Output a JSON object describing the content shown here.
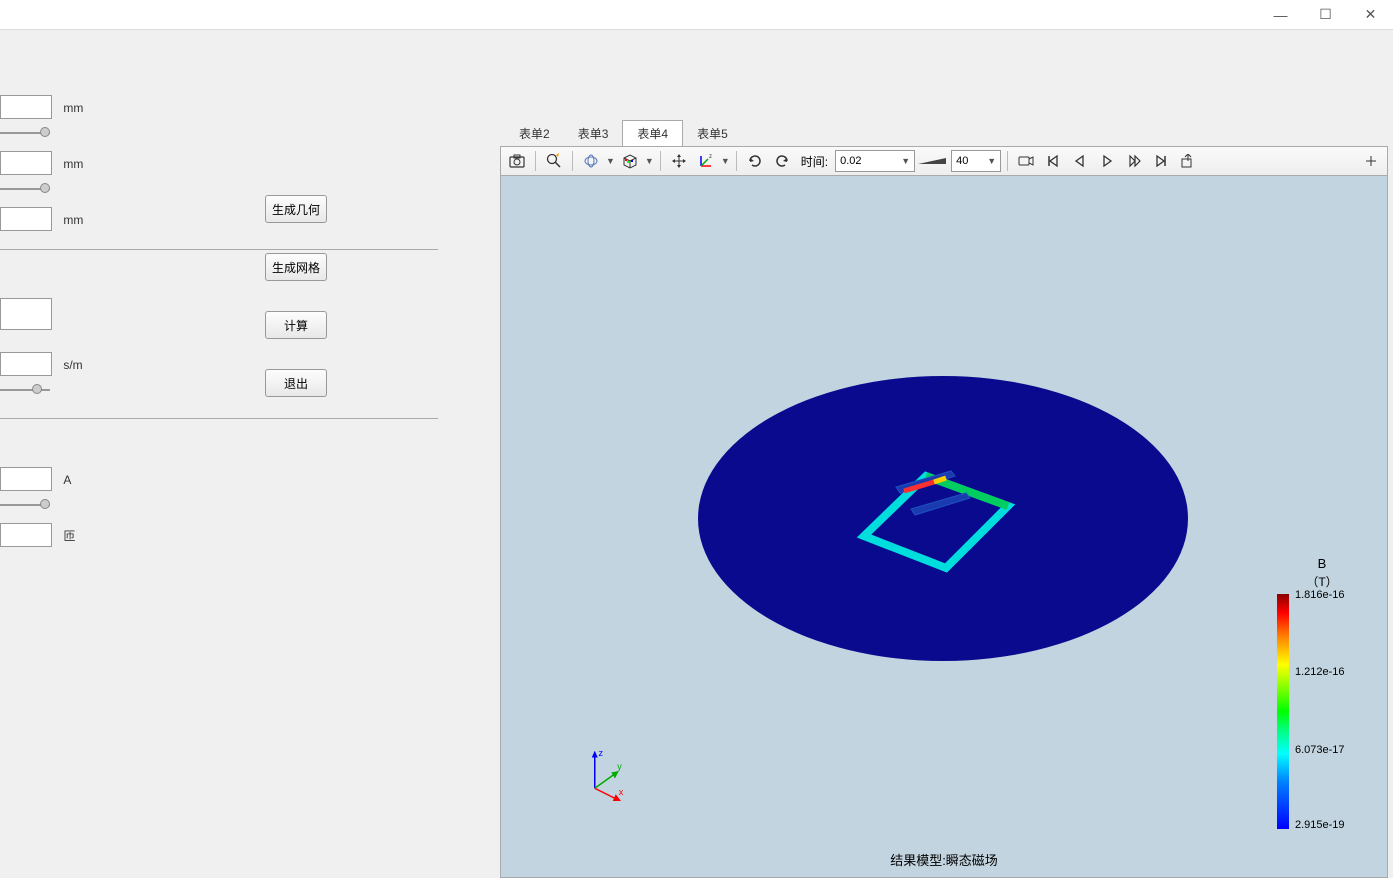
{
  "titlebar": {
    "minimize": "—",
    "maximize": "☐",
    "close": "✕"
  },
  "sidebar": {
    "params": [
      {
        "unit": "mm",
        "has_slider": true
      },
      {
        "unit": "mm",
        "has_slider": true
      },
      {
        "unit": "mm",
        "has_slider": false
      }
    ],
    "params2": [
      {
        "unit": "",
        "has_slider": false
      },
      {
        "unit": "s/m",
        "has_slider": true
      }
    ],
    "params3": [
      {
        "unit": "A",
        "has_slider": true
      },
      {
        "unit": "匝",
        "has_slider": false
      }
    ],
    "buttons": {
      "gen_geom": "生成几何",
      "gen_mesh": "生成网格",
      "compute": "计算",
      "exit": "退出"
    }
  },
  "tabs": [
    {
      "label": "表单2",
      "active": false
    },
    {
      "label": "表单3",
      "active": false
    },
    {
      "label": "表单4",
      "active": true
    },
    {
      "label": "表单5",
      "active": false
    }
  ],
  "toolbar": {
    "time_label": "时间:",
    "time_value": "0.02",
    "frame_value": "40"
  },
  "colorbar": {
    "title": "B",
    "unit": "（T）",
    "labels": [
      {
        "value": "1.816e-16",
        "pos": 0
      },
      {
        "value": "1.212e-16",
        "pos": 33
      },
      {
        "value": "6.073e-17",
        "pos": 66
      },
      {
        "value": "2.915e-19",
        "pos": 99
      }
    ]
  },
  "result_caption": "结果模型:瞬态磁场",
  "axis": {
    "x": "x",
    "y": "y",
    "z": "z"
  }
}
